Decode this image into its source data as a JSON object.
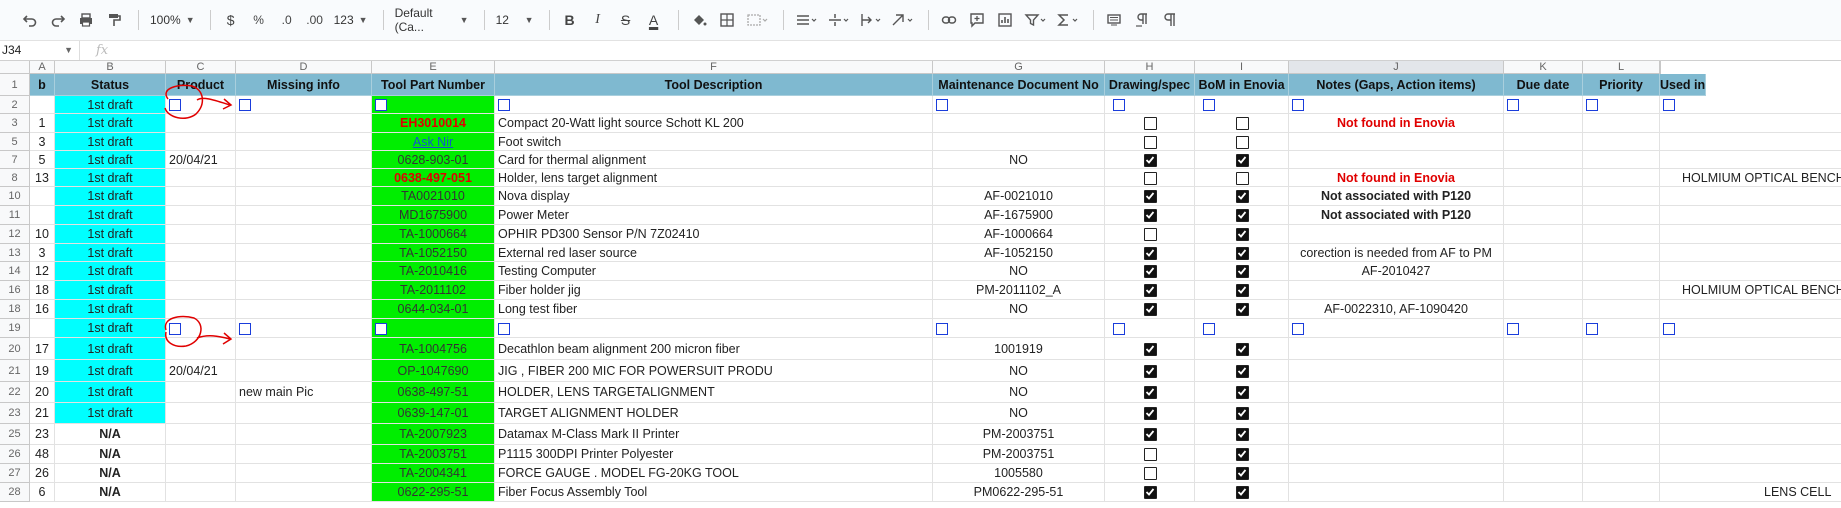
{
  "toolbar": {
    "zoom": "100%",
    "currency": "$",
    "percent": "%",
    "dec_less": ".0",
    "dec_more": ".00",
    "format_more": "123",
    "font": "Default (Ca...",
    "font_size": "12",
    "bold": "B",
    "italic": "I",
    "strike": "S",
    "text_color": "A"
  },
  "formula_bar": {
    "name_box": "J34",
    "fx": "fx",
    "value": ""
  },
  "columns": [
    "A",
    "B",
    "C",
    "D",
    "E",
    "F",
    "G",
    "H",
    "I",
    "J",
    "K",
    "L",
    ""
  ],
  "header_row": {
    "row_no": "1",
    "cells": [
      "b",
      "Status",
      "Product",
      "Missing info",
      "Tool Part Number",
      "Tool Description",
      "Maintenance Document No",
      "Drawing/spec",
      "BoM in Enovia",
      "Notes (Gaps, Action items)",
      "Due date",
      "Priority",
      "Used in"
    ]
  },
  "rows": [
    {
      "row": "2",
      "type": "checks",
      "a": "",
      "status": "1st draft"
    },
    {
      "row": "3",
      "a": "1",
      "status": "1st draft",
      "product": "",
      "missing": "",
      "part": "EH3010014",
      "part_style": "red",
      "desc": "Compact 20-Watt light source Schott KL 200",
      "maint": "",
      "drawing": false,
      "bom": false,
      "notes": "Not found in Enovia",
      "notes_style": "red",
      "used": ""
    },
    {
      "row": "5",
      "a": "3",
      "status": "1st draft",
      "product": "",
      "missing": "",
      "part": "Ask Nir",
      "part_style": "link",
      "desc": "Foot switch",
      "maint": "",
      "drawing": false,
      "bom": false,
      "notes": "",
      "used": ""
    },
    {
      "row": "7",
      "a": "5",
      "status": "1st draft",
      "product": "20/04/21",
      "missing": "",
      "part": "0628-903-01",
      "desc": "Card for thermal alignment",
      "maint": "NO",
      "drawing": true,
      "bom": true,
      "notes": "",
      "used": ""
    },
    {
      "row": "8",
      "a": "13",
      "status": "1st draft",
      "product": "",
      "missing": "",
      "part": "0638-497-051",
      "part_style": "red",
      "desc": "Holder, lens target alignment",
      "maint": "",
      "drawing": false,
      "bom": false,
      "notes": "Not found in Enovia",
      "notes_style": "red",
      "used": "HOLMIUM OPTICAL BENCH"
    },
    {
      "row": "10",
      "a": "",
      "status": "1st draft",
      "product": "",
      "missing": "",
      "part": "TA0021010",
      "desc": "Nova display",
      "maint": "AF-0021010",
      "drawing": true,
      "bom": true,
      "notes": "Not associated with P120",
      "notes_style": "bold",
      "used": ""
    },
    {
      "row": "11",
      "a": "",
      "status": "1st draft",
      "product": "",
      "missing": "",
      "part": "MD1675900",
      "desc": "Power Meter",
      "maint": "AF-1675900",
      "drawing": true,
      "bom": true,
      "notes": "Not associated with P120",
      "notes_style": "bold",
      "used": ""
    },
    {
      "row": "12",
      "a": "10",
      "status": "1st draft",
      "product": "",
      "missing": "",
      "part": "TA-1000664",
      "desc": "OPHIR PD300 Sensor P/N 7Z02410",
      "maint": "AF-1000664",
      "drawing": false,
      "bom": true,
      "notes": "",
      "used": ""
    },
    {
      "row": "13",
      "a": "3",
      "status": "1st draft",
      "product": "",
      "missing": "",
      "part": "TA-1052150",
      "desc": "External red laser source",
      "maint": "AF-1052150",
      "drawing": true,
      "bom": true,
      "notes": "corection is needed from AF to PM",
      "used": ""
    },
    {
      "row": "14",
      "a": "12",
      "status": "1st draft",
      "product": "",
      "missing": "",
      "part": "TA-2010416",
      "desc": "Testing Computer",
      "maint": "NO",
      "drawing": true,
      "bom": true,
      "notes": "AF-2010427",
      "used": ""
    },
    {
      "row": "16",
      "a": "18",
      "status": "1st draft",
      "product": "",
      "missing": "",
      "part": "TA-2011102",
      "desc": "Fiber holder jig",
      "maint": "PM-2011102_A",
      "drawing": true,
      "bom": true,
      "notes": "",
      "used": "HOLMIUM OPTICAL BENCH"
    },
    {
      "row": "18",
      "a": "16",
      "status": "1st draft",
      "product": "",
      "missing": "",
      "part": "0644-034-01",
      "desc": "Long test fiber",
      "maint": "NO",
      "drawing": true,
      "bom": true,
      "notes": "AF-0022310, AF-1090420",
      "used": ""
    },
    {
      "row": "19",
      "type": "checks",
      "a": "",
      "status": "1st draft"
    },
    {
      "row": "20",
      "a": "17",
      "status": "1st draft",
      "product": "",
      "missing": "",
      "part": "TA-1004756",
      "desc": "Decathlon beam alignment 200 micron fiber",
      "maint": "1001919",
      "drawing": true,
      "bom": true,
      "notes": "",
      "used": ""
    },
    {
      "row": "21",
      "a": "19",
      "status": "1st draft",
      "product": "20/04/21",
      "missing": "",
      "part": "OP-1047690",
      "desc": "JIG , FIBER 200 MIC FOR POWERSUIT PRODU",
      "maint": "NO",
      "drawing": true,
      "bom": true,
      "notes": "",
      "used": ""
    },
    {
      "row": "22",
      "a": "20",
      "status": "1st draft",
      "product": "",
      "missing": "new main Pic",
      "part": "0638-497-51",
      "desc": "HOLDER, LENS TARGETALIGNMENT",
      "maint": "NO",
      "drawing": true,
      "bom": true,
      "notes": "",
      "used": ""
    },
    {
      "row": "23",
      "a": "21",
      "status": "1st draft",
      "product": "",
      "missing": "",
      "part": "0639-147-01",
      "desc": "TARGET ALIGNMENT HOLDER",
      "maint": "NO",
      "drawing": true,
      "bom": true,
      "notes": "",
      "used": ""
    },
    {
      "row": "25",
      "a": "23",
      "status": "N/A",
      "product": "",
      "missing": "",
      "part": "TA-2007923",
      "desc": "Datamax M-Class Mark II Printer",
      "maint": "PM-2003751",
      "drawing": true,
      "bom": true,
      "notes": "",
      "used": ""
    },
    {
      "row": "26",
      "a": "48",
      "status": "N/A",
      "product": "",
      "missing": "",
      "part": "TA-2003751",
      "desc": "P1115 300DPI Printer Polyester",
      "maint": "PM-2003751",
      "drawing": false,
      "bom": true,
      "notes": "",
      "used": ""
    },
    {
      "row": "27",
      "a": "26",
      "status": "N/A",
      "product": "",
      "missing": "",
      "part": "TA-2004341",
      "desc": "FORCE GAUGE . MODEL FG-20KG TOOL",
      "maint": "1005580",
      "drawing": false,
      "bom": true,
      "notes": "",
      "used": ""
    },
    {
      "row": "28",
      "a": "6",
      "status": "N/A",
      "product": "",
      "missing": "",
      "part": "0622-295-51",
      "desc": "Fiber Focus Assembly Tool",
      "maint": "PM0622-295-51",
      "drawing": true,
      "bom": true,
      "notes": "",
      "used": "LENS CELL"
    }
  ],
  "colors": {
    "header_bg": "#7fb9d0",
    "status_bg": "#00ffff",
    "part_bg": "#00ee00",
    "annotation": "#e00000",
    "check_box": "#1a3ddb"
  }
}
